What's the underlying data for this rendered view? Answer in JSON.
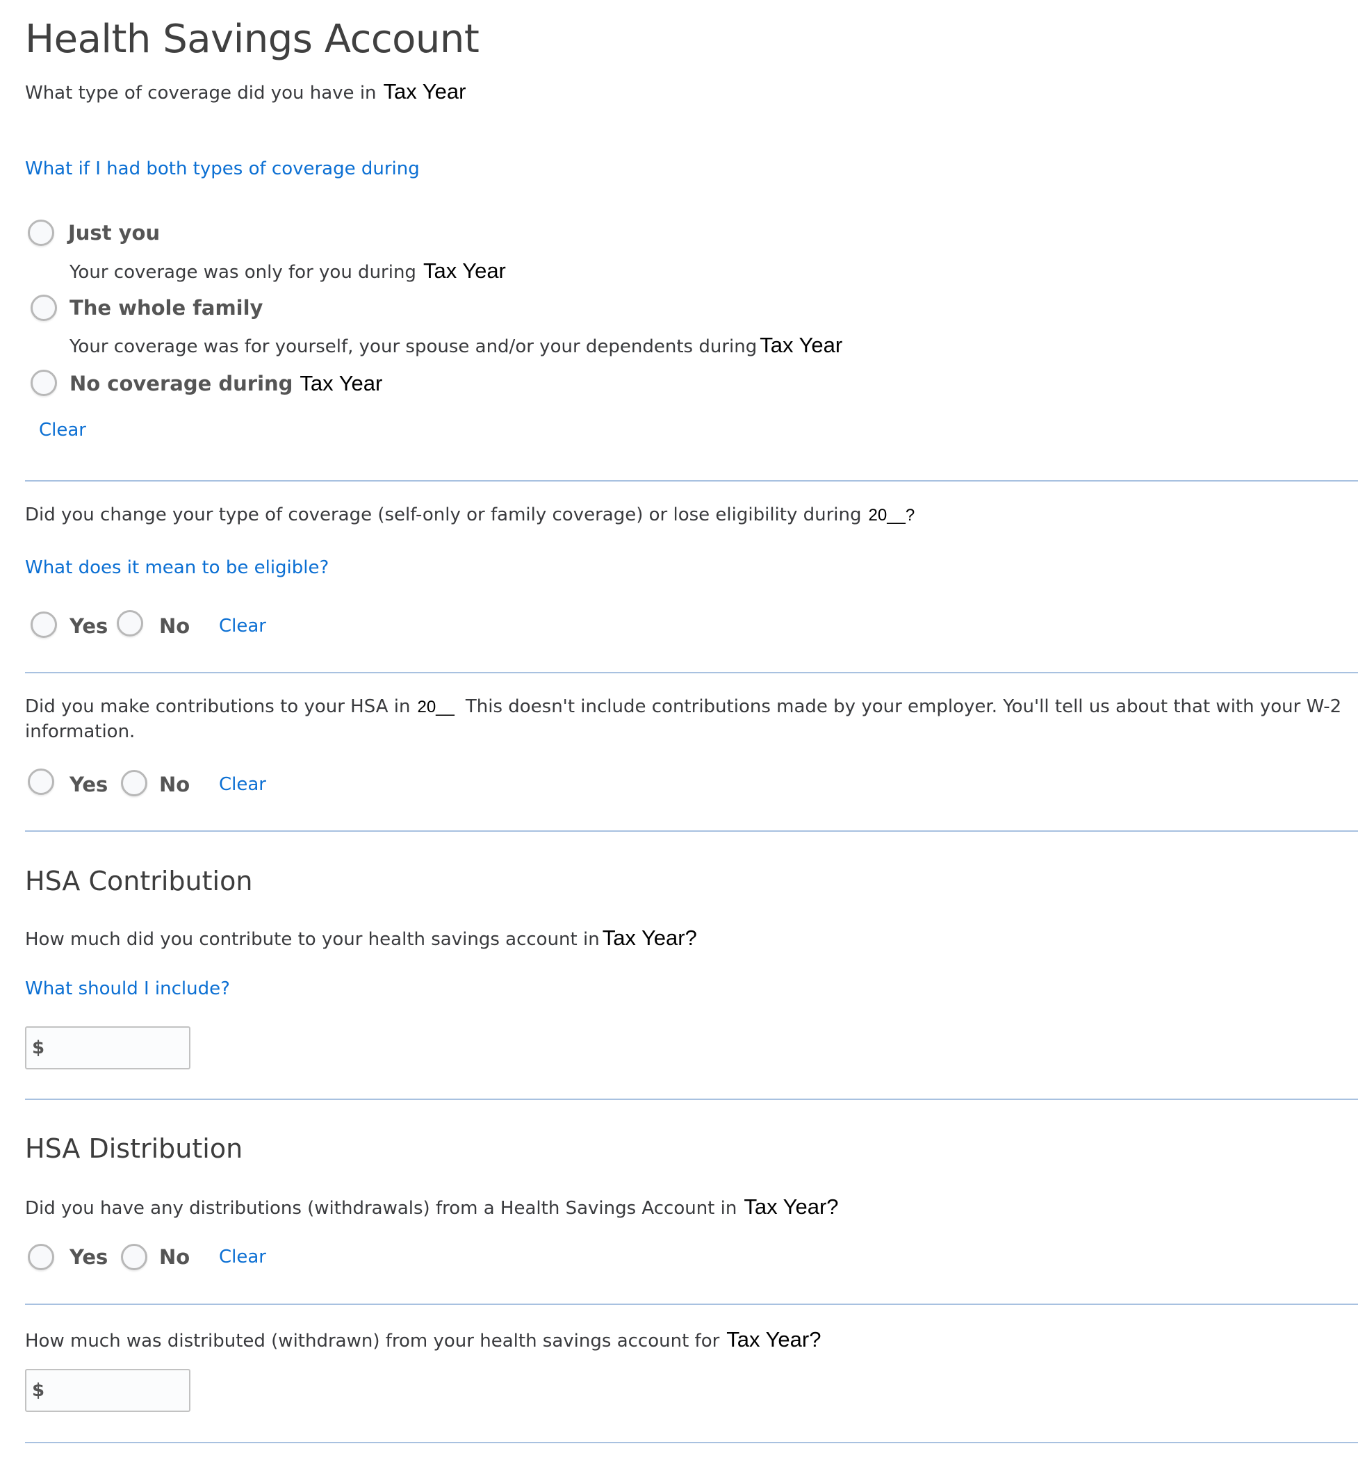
{
  "page": {
    "title": "Health Savings Account"
  },
  "coverage": {
    "question": "What type of coverage did you have in",
    "question_year": "Tax Year",
    "help_link": "What if I had both types of coverage during",
    "options": [
      {
        "label": "Just you",
        "description": "Your coverage was only for you during",
        "year": "Tax Year"
      },
      {
        "label": "The whole family",
        "description": "Your coverage was for yourself, your spouse and/or your dependents during",
        "year": "Tax Year"
      },
      {
        "label": "No coverage during",
        "year": "Tax Year"
      }
    ],
    "clear_label": "Clear"
  },
  "change": {
    "question": "Did you change your type of coverage (self-only or family coverage) or lose eligibility during",
    "question_year": "20__?",
    "help_link": "What does it mean to be eligible?",
    "yes_label": "Yes",
    "no_label": "No",
    "clear_label": "Clear"
  },
  "contributions": {
    "question_part1": "Did you make contributions to your HSA in",
    "question_year": "20__",
    "question_part2": "This doesn't include contributions made by your employer. You'll tell us about that with your W-2",
    "question_part3": "information.",
    "yes_label": "Yes",
    "no_label": "No",
    "clear_label": "Clear"
  },
  "hsa_contribution": {
    "heading": "HSA Contribution",
    "question": "How much did you contribute to your health savings account in",
    "question_year": "Tax Year?",
    "help_link": "What should I include?",
    "currency_symbol": "$",
    "amount_value": ""
  },
  "hsa_distribution": {
    "heading": "HSA Distribution",
    "question": "Did you have any distributions (withdrawals) from a Health Savings Account in",
    "question_year": "Tax Year?",
    "yes_label": "Yes",
    "no_label": "No",
    "clear_label": "Clear"
  },
  "distribution_amount": {
    "question": "How much was distributed (withdrawn) from your health savings account for",
    "question_year": "Tax Year?",
    "currency_symbol": "$",
    "amount_value": ""
  }
}
